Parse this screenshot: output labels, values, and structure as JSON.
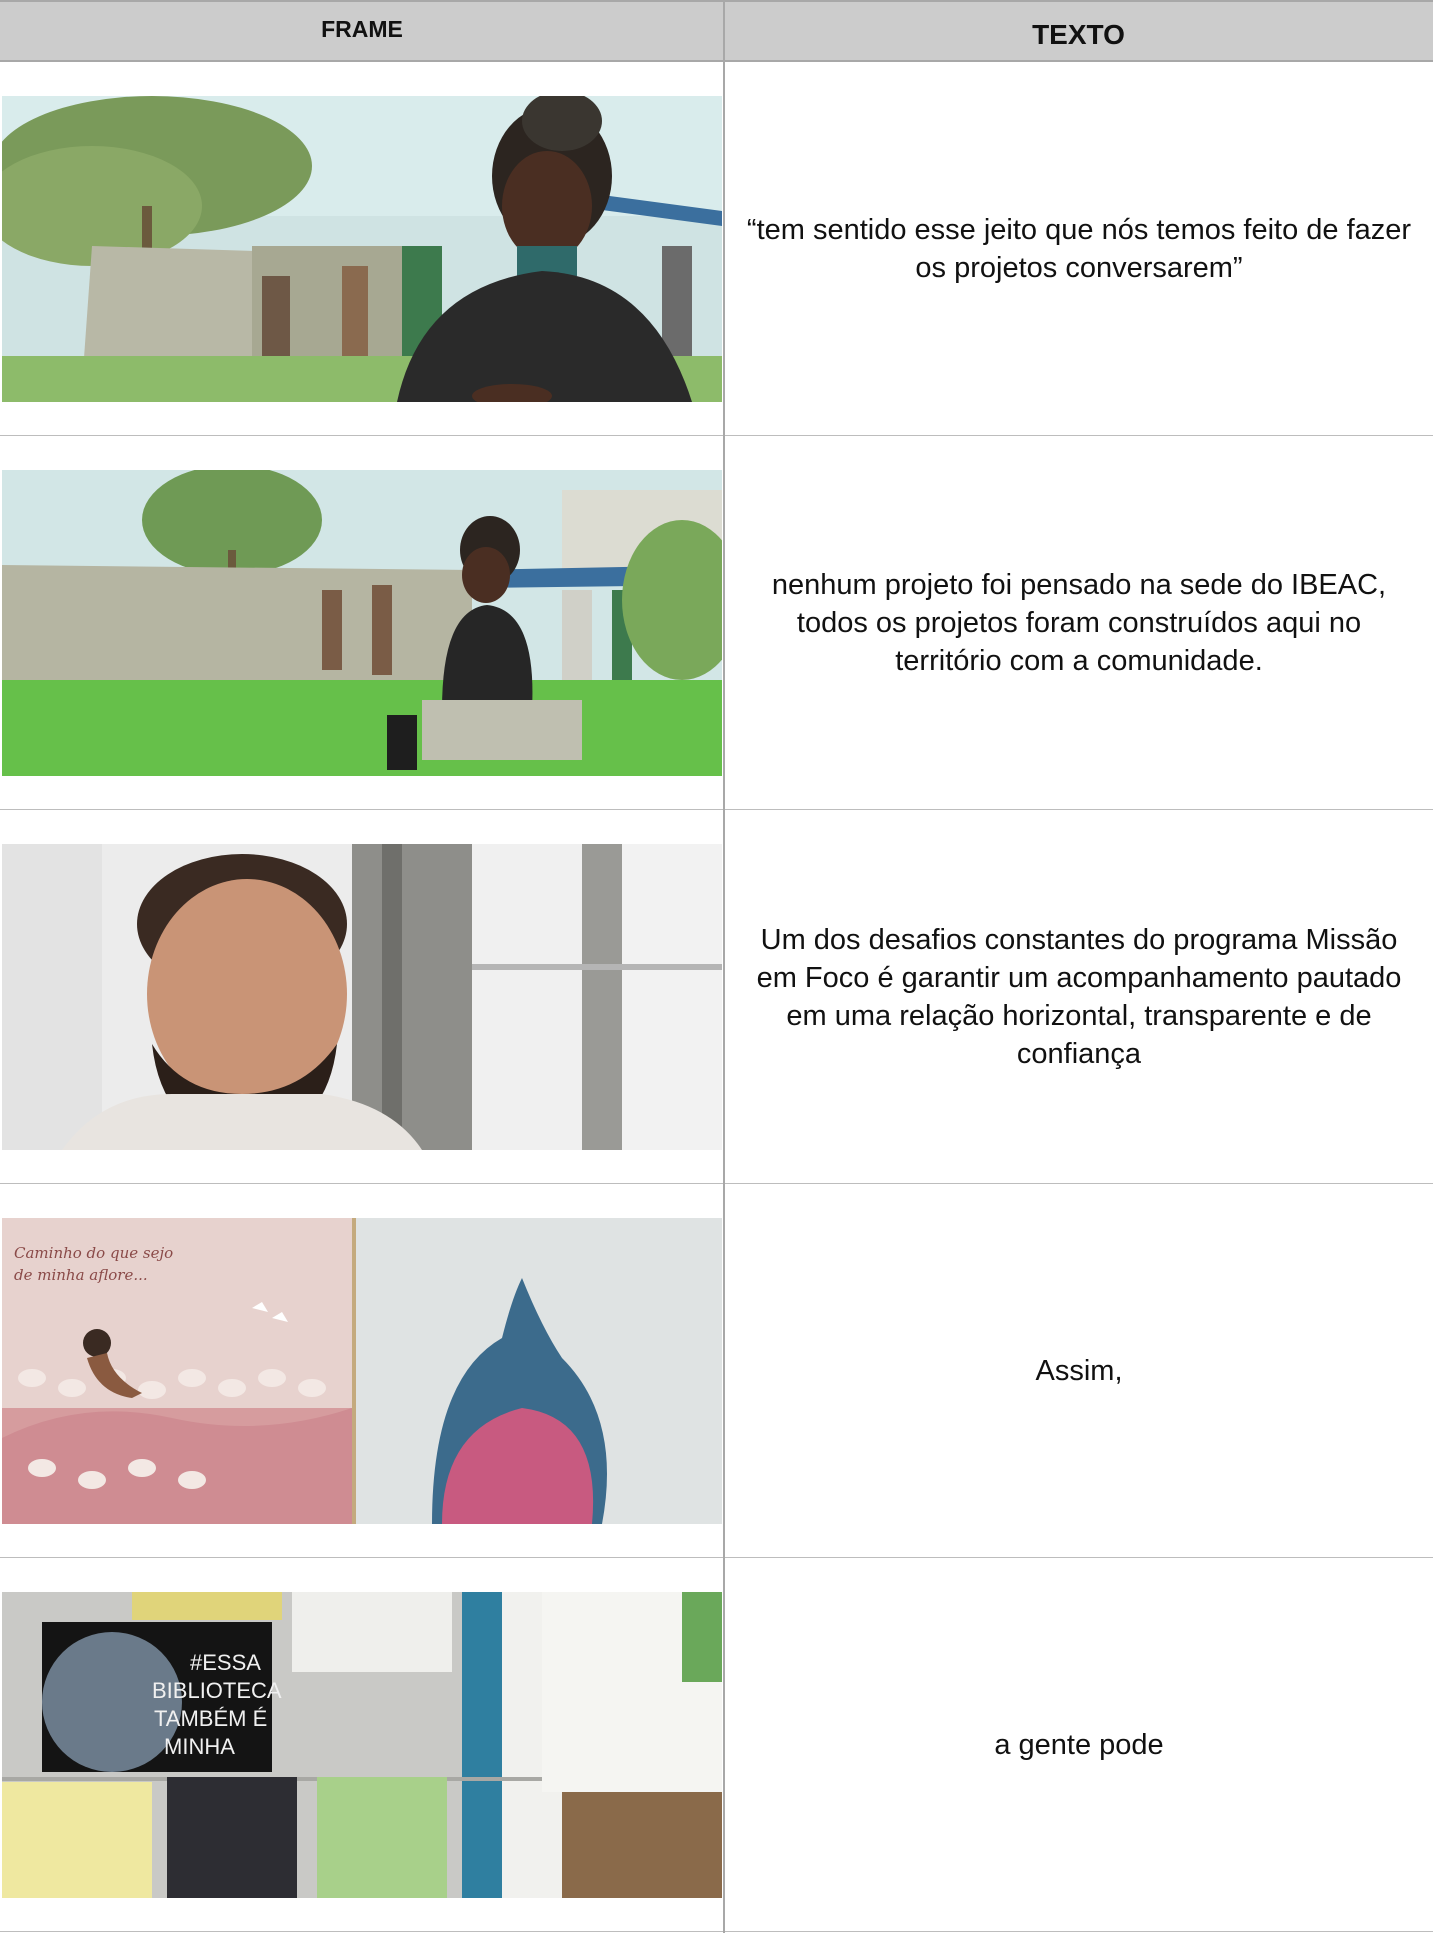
{
  "header": {
    "frame_label": "FRAME",
    "texto_label": "TEXTO"
  },
  "rows": [
    {
      "text": "“tem sentido esse jeito que nós temos feito de fazer os projetos conversarem”"
    },
    {
      "text": "nenhum projeto foi pensado na sede do IBEAC, todos os projetos foram construídos aqui no território com a comunidade."
    },
    {
      "text": "Um dos desafios constantes do programa Missão em Foco é garantir um acompanhamento pautado em uma relação horizontal, transparente e de confiança"
    },
    {
      "text": "Assim,"
    },
    {
      "text": "a gente pode"
    }
  ],
  "frame4_poster": {
    "line1": "Caminho do que sejo",
    "line2": "de minha aflore..."
  },
  "frame5_sign": {
    "line1": "#ESSA",
    "line2": "BIBLIOTECA",
    "line3": "TAMBÉM É",
    "line4": "MINHA"
  },
  "colors": {
    "header_bg": "#cccccc",
    "grid_line": "#a8a8a8"
  }
}
